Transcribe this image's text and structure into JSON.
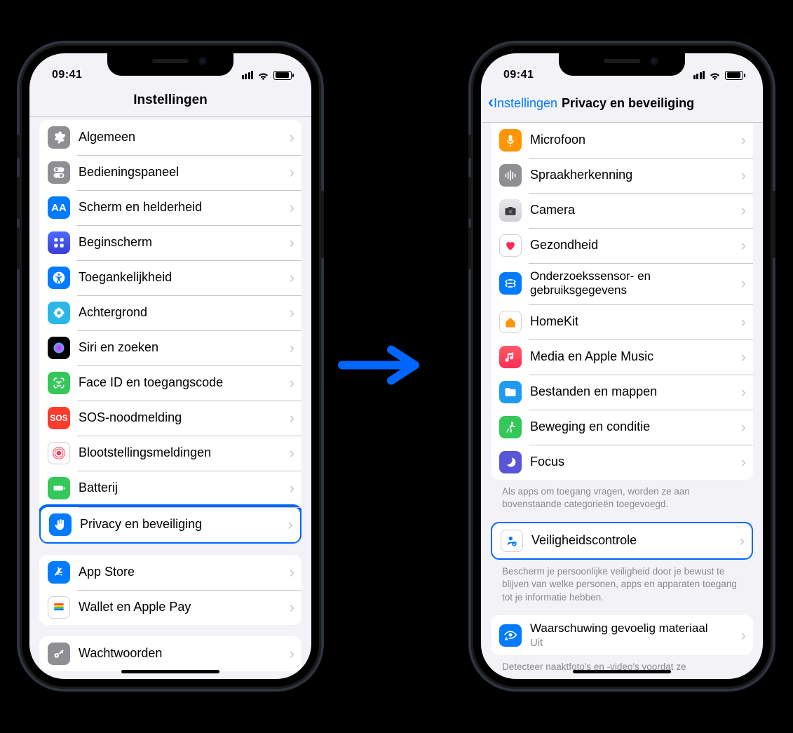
{
  "status": {
    "time": "09:41"
  },
  "phone_left": {
    "title": "Instellingen",
    "group1": [
      {
        "label": "Algemeen",
        "icon": "gear-icon",
        "bg": "bg-gray"
      },
      {
        "label": "Bedieningspaneel",
        "icon": "switches-icon",
        "bg": "bg-gray"
      },
      {
        "label": "Scherm en helderheid",
        "icon": "text-size-icon",
        "bg": "bg-blue"
      },
      {
        "label": "Beginscherm",
        "icon": "grid-icon",
        "bg": "bg-indigo"
      },
      {
        "label": "Toegankelijkheid",
        "icon": "accessibility-icon",
        "bg": "bg-blue"
      },
      {
        "label": "Achtergrond",
        "icon": "flower-icon",
        "bg": "bg-blue",
        "variant": "cyan-flower"
      },
      {
        "label": "Siri en zoeken",
        "icon": "siri-icon",
        "bg": "bg-black"
      },
      {
        "label": "Face ID en toegangscode",
        "icon": "faceid-icon",
        "bg": "bg-green"
      },
      {
        "label": "SOS-noodmelding",
        "icon": "sos-icon",
        "bg": "bg-red"
      },
      {
        "label": "Blootstellingsmeldingen",
        "icon": "exposure-icon",
        "bg": "bg-white"
      },
      {
        "label": "Batterij",
        "icon": "battery-icon",
        "bg": "bg-green"
      },
      {
        "label": "Privacy en beveiliging",
        "icon": "hand-icon",
        "bg": "bg-blue",
        "highlight": true
      }
    ],
    "group2": [
      {
        "label": "App Store",
        "icon": "appstore-icon",
        "bg": "bg-blue"
      },
      {
        "label": "Wallet en Apple Pay",
        "icon": "wallet-icon",
        "bg": "bg-black"
      }
    ],
    "group3": [
      {
        "label": "Wachtwoorden",
        "icon": "key-icon",
        "bg": "bg-gray"
      }
    ]
  },
  "phone_right": {
    "back_label": "Instellingen",
    "title": "Privacy en beveiliging",
    "groupA": [
      {
        "label": "Microfoon",
        "icon": "mic-icon",
        "bg": "bg-orange"
      },
      {
        "label": "Spraakherkenning",
        "icon": "waveform-icon",
        "bg": "bg-gray"
      },
      {
        "label": "Camera",
        "icon": "camera-icon",
        "bg": "bg-white",
        "dark": true
      },
      {
        "label": "Gezondheid",
        "icon": "heart-icon",
        "bg": "bg-white"
      },
      {
        "label": "Onderzoekssensor- en gebruiksgegevens",
        "icon": "research-icon",
        "bg": "bg-blue"
      },
      {
        "label": "HomeKit",
        "icon": "home-icon",
        "bg": "bg-white"
      },
      {
        "label": "Media en Apple Music",
        "icon": "music-icon",
        "bg": "bg-red"
      },
      {
        "label": "Bestanden en mappen",
        "icon": "folder-icon",
        "bg": "bg-blue",
        "variant": "folder"
      },
      {
        "label": "Beweging en conditie",
        "icon": "fitness-icon",
        "bg": "bg-green"
      },
      {
        "label": "Focus",
        "icon": "focus-icon",
        "bg": "bg-indigo"
      }
    ],
    "noteA": "Als apps om toegang vragen, worden ze aan bovenstaande categorieën toegevoegd.",
    "groupB": [
      {
        "label": "Veiligheidscontrole",
        "icon": "person-shield-icon",
        "bg": "bg-white",
        "highlight": true
      }
    ],
    "noteB": "Bescherm je persoonlijke veiligheid door je bewust te blijven van welke personen, apps en apparaten toegang tot je informatie hebben.",
    "groupC": {
      "label": "Waarschuwing gevoelig materiaal",
      "sub": "Uit",
      "icon": "eye-warn-icon",
      "bg": "bg-blue"
    },
    "noteC": "Detecteer naaktfoto's en -video's voordat ze"
  }
}
